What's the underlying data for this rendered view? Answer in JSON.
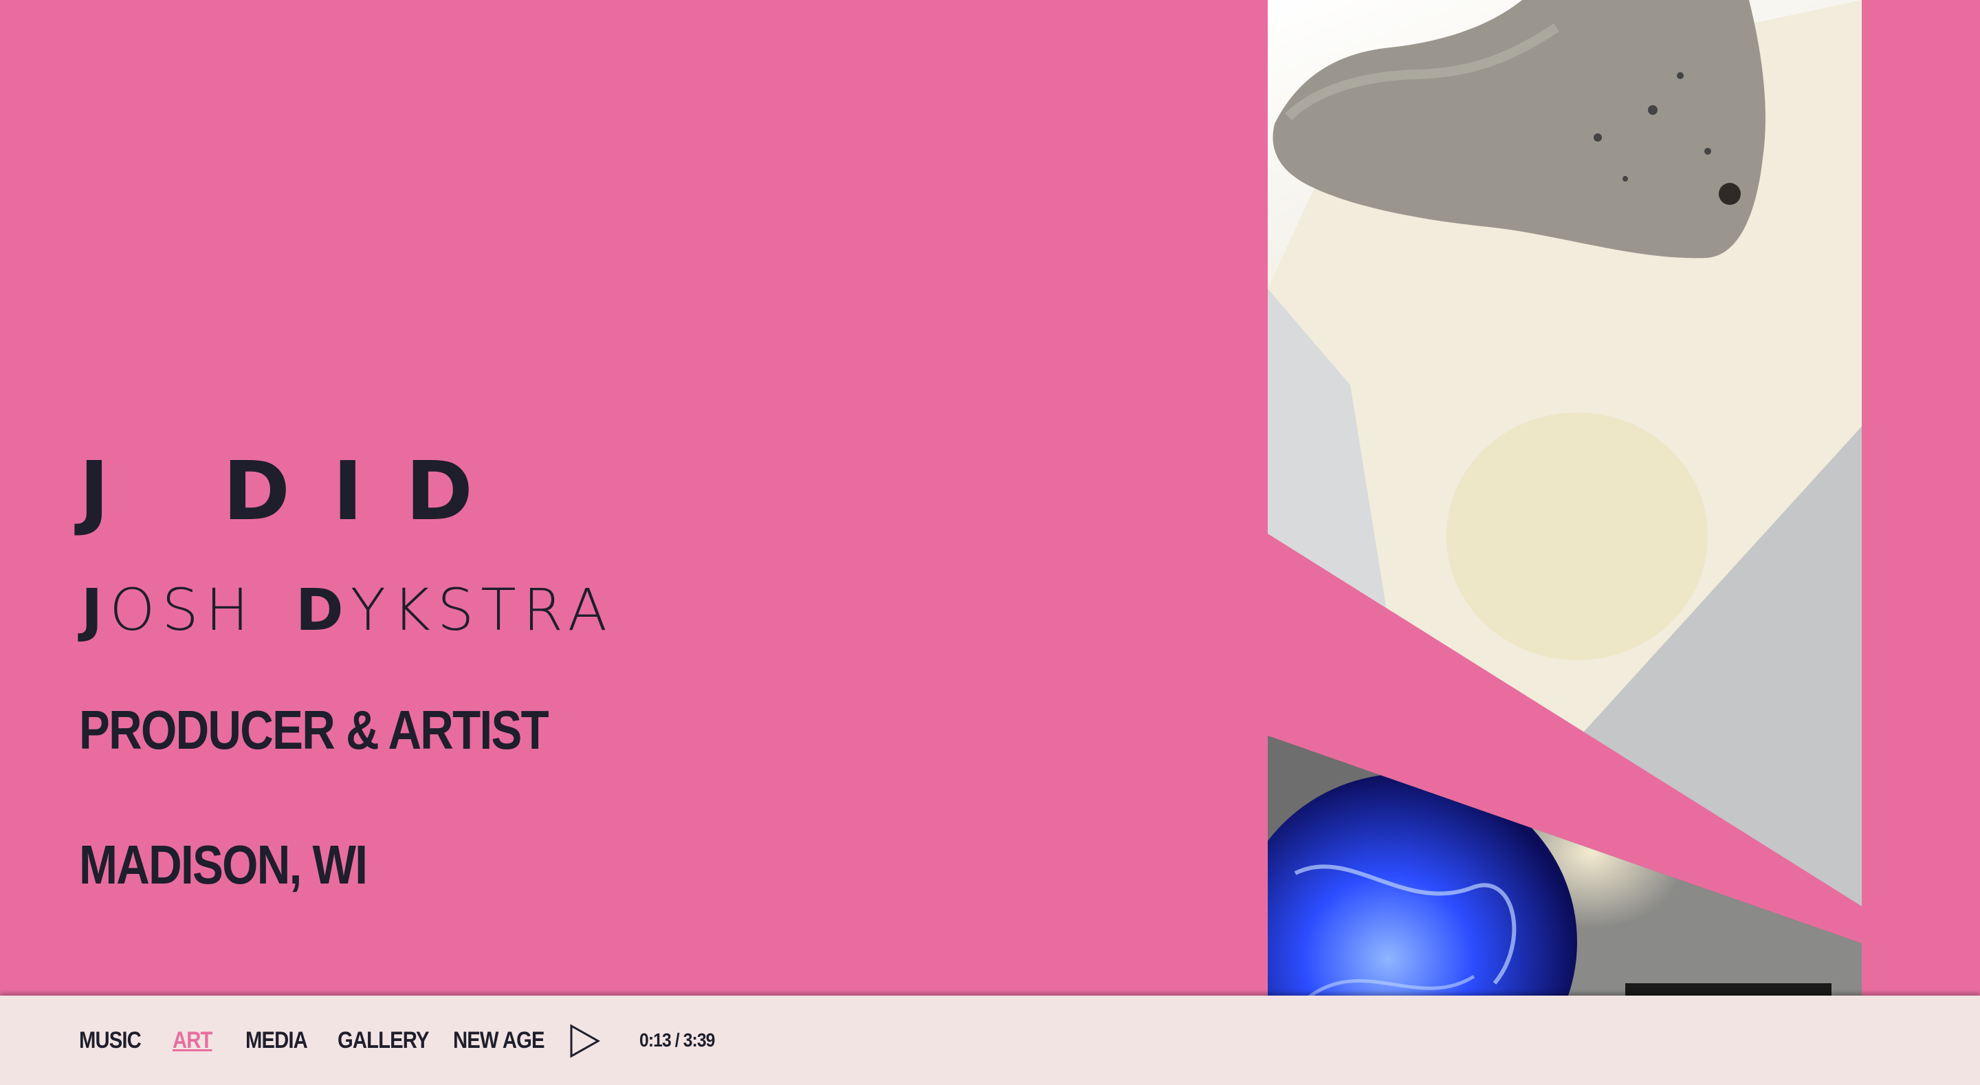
{
  "brand": {
    "mark": "J DID"
  },
  "artist": {
    "first_initial": "J",
    "first_rest": "OSH",
    "last_initial": "D",
    "last_rest": "YKSTRA"
  },
  "tagline": "PRODUCER & ARTIST",
  "location": "MADISON, WI",
  "nav": {
    "items": [
      {
        "label": "MUSIC",
        "active": false
      },
      {
        "label": "ART",
        "active": true
      },
      {
        "label": "MEDIA",
        "active": false
      },
      {
        "label": "GALLERY",
        "active": false
      },
      {
        "label": "NEW AGE",
        "active": false
      }
    ]
  },
  "player": {
    "play_icon": "play-icon",
    "time": "0:13 / 3:39"
  },
  "colors": {
    "background": "#e86d9e",
    "bar": "#f3e4e4",
    "text": "#1e1e2c",
    "accent": "#e86d9e"
  }
}
